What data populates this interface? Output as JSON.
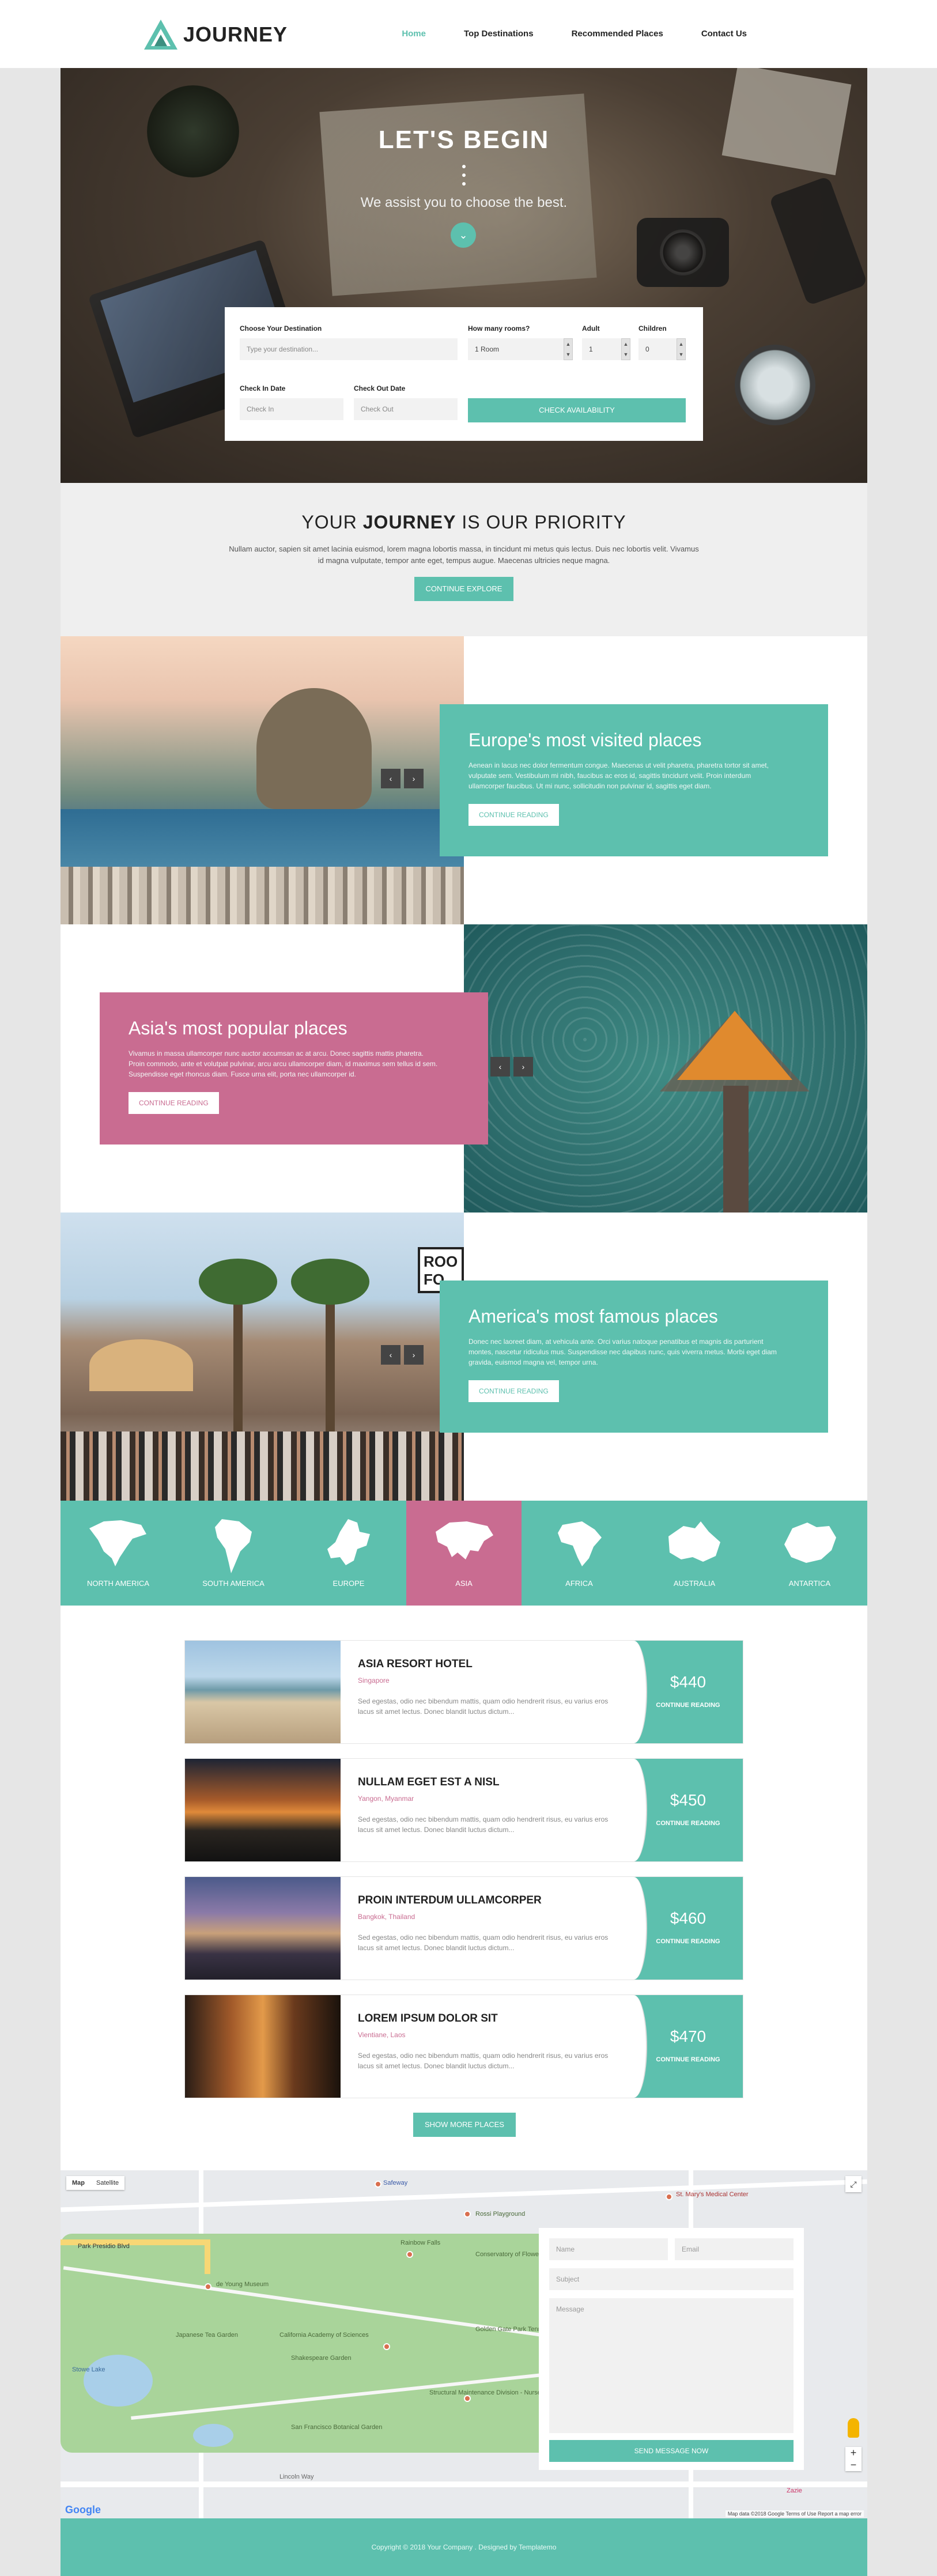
{
  "brand": {
    "name": "JOURNEY",
    "accent": "#5dc0ae",
    "pink": "#c96c91"
  },
  "nav": {
    "items": [
      {
        "label": "Home",
        "active": true
      },
      {
        "label": "Top Destinations"
      },
      {
        "label": "Recommended Places"
      },
      {
        "label": "Contact Us"
      }
    ]
  },
  "hero": {
    "title": "LET'S BEGIN",
    "subtitle": "We assist you to choose the best.",
    "booking": {
      "destination_label": "Choose Your Destination",
      "destination_placeholder": "Type your destination...",
      "rooms_label": "How many rooms?",
      "rooms_value": "1 Room",
      "adult_label": "Adult",
      "adult_value": "1",
      "children_label": "Children",
      "children_value": "0",
      "checkin_label": "Check In Date",
      "checkin_placeholder": "Check In",
      "checkout_label": "Check Out Date",
      "checkout_placeholder": "Check Out",
      "button": "CHECK AVAILABILITY"
    }
  },
  "priority": {
    "title_pre": "YOUR ",
    "title_bold": "JOURNEY",
    "title_post": " IS OUR PRIORITY",
    "text": "Nullam auctor, sapien sit amet lacinia euismod, lorem magna lobortis massa, in tincidunt mi metus quis lectus. Duis nec lobortis velit. Vivamus id magna vulputate, tempor ante eget, tempus augue. Maecenas ultricies neque magna.",
    "button": "CONTINUE EXPLORE"
  },
  "features": [
    {
      "title": "Europe's most visited places",
      "text": "Aenean in lacus nec dolor fermentum congue. Maecenas ut velit pharetra, pharetra tortor sit amet, vulputate sem. Vestibulum mi nibh, faucibus ac eros id, sagittis tincidunt velit. Proin interdum ullamcorper faucibus. Ut mi nunc, sollicitudin non pulvinar id, sagittis eget diam.",
      "button": "CONTINUE READING"
    },
    {
      "title": "Asia's most popular places",
      "text": "Vivamus in massa ullamcorper nunc auctor accumsan ac at arcu. Donec sagittis mattis pharetra. Proin commodo, ante et volutpat pulvinar, arcu arcu ullamcorper diam, id maximus sem tellus id sem. Suspendisse eget rhoncus diam. Fusce urna elit, porta nec ullamcorper id.",
      "button": "CONTINUE READING"
    },
    {
      "title": "America's most famous places",
      "text": "Donec nec laoreet diam, at vehicula ante. Orci varius natoque penatibus et magnis dis parturient montes, nascetur ridiculus mus. Suspendisse nec dapibus nunc, quis viverra metus. Morbi eget diam gravida, euismod magna vel, tempor urna.",
      "button": "CONTINUE READING"
    }
  ],
  "slider": {
    "prev": "‹",
    "next": "›"
  },
  "continents": [
    {
      "label": "NORTH AMERICA",
      "icon": "north-america-icon"
    },
    {
      "label": "SOUTH AMERICA",
      "icon": "south-america-icon"
    },
    {
      "label": "EUROPE",
      "icon": "europe-icon"
    },
    {
      "label": "ASIA",
      "icon": "asia-icon",
      "active": true
    },
    {
      "label": "AFRICA",
      "icon": "africa-icon"
    },
    {
      "label": "AUSTRALIA",
      "icon": "australia-icon"
    },
    {
      "label": "ANTARTICA",
      "icon": "antarctica-icon"
    }
  ],
  "hotels": [
    {
      "title": "ASIA RESORT HOTEL",
      "location": "Singapore",
      "text": "Sed egestas, odio nec bibendum mattis, quam odio hendrerit risus, eu varius eros lacus sit amet lectus. Donec blandit luctus dictum...",
      "price": "$440",
      "button": "CONTINUE READING"
    },
    {
      "title": "NULLAM EGET EST A NISL",
      "location": "Yangon, Myanmar",
      "text": "Sed egestas, odio nec bibendum mattis, quam odio hendrerit risus, eu varius eros lacus sit amet lectus. Donec blandit luctus dictum...",
      "price": "$450",
      "button": "CONTINUE READING"
    },
    {
      "title": "PROIN INTERDUM ULLAMCORPER",
      "location": "Bangkok, Thailand",
      "text": "Sed egestas, odio nec bibendum mattis, quam odio hendrerit risus, eu varius eros lacus sit amet lectus. Donec blandit luctus dictum...",
      "price": "$460",
      "button": "CONTINUE READING"
    },
    {
      "title": "LOREM IPSUM DOLOR SIT",
      "location": "Vientiane, Laos",
      "text": "Sed egestas, odio nec bibendum mattis, quam odio hendrerit risus, eu varius eros lacus sit amet lectus. Donec blandit luctus dictum...",
      "price": "$470",
      "button": "CONTINUE READING"
    }
  ],
  "show_more": "SHOW MORE PLACES",
  "map": {
    "type_map": "Map",
    "type_satellite": "Satellite",
    "labels": [
      "Safeway",
      "Rossi Playground",
      "St. Mary's Medical Center",
      "Park Presidio Blvd",
      "Rainbow Falls",
      "Conservatory of Flowers",
      "de Young Museum",
      "Japanese Tea Garden",
      "California Academy of Sciences",
      "Shakespeare Garden",
      "Golden Gate Park Tennis Center",
      "Structural Maintenance Division - Nursery",
      "San Francisco Botanical Garden",
      "Lincoln Way",
      "Stowe Lake",
      "Zazie"
    ],
    "google": "Google",
    "attribution": "Map data ©2018 Google   Terms of Use   Report a map error"
  },
  "contact": {
    "name_placeholder": "Name",
    "email_placeholder": "Email",
    "subject_placeholder": "Subject",
    "message_placeholder": "Message",
    "button": "SEND MESSAGE NOW"
  },
  "footer": {
    "text": "Copyright © 2018 Your Company . Designed by Templatemo"
  }
}
